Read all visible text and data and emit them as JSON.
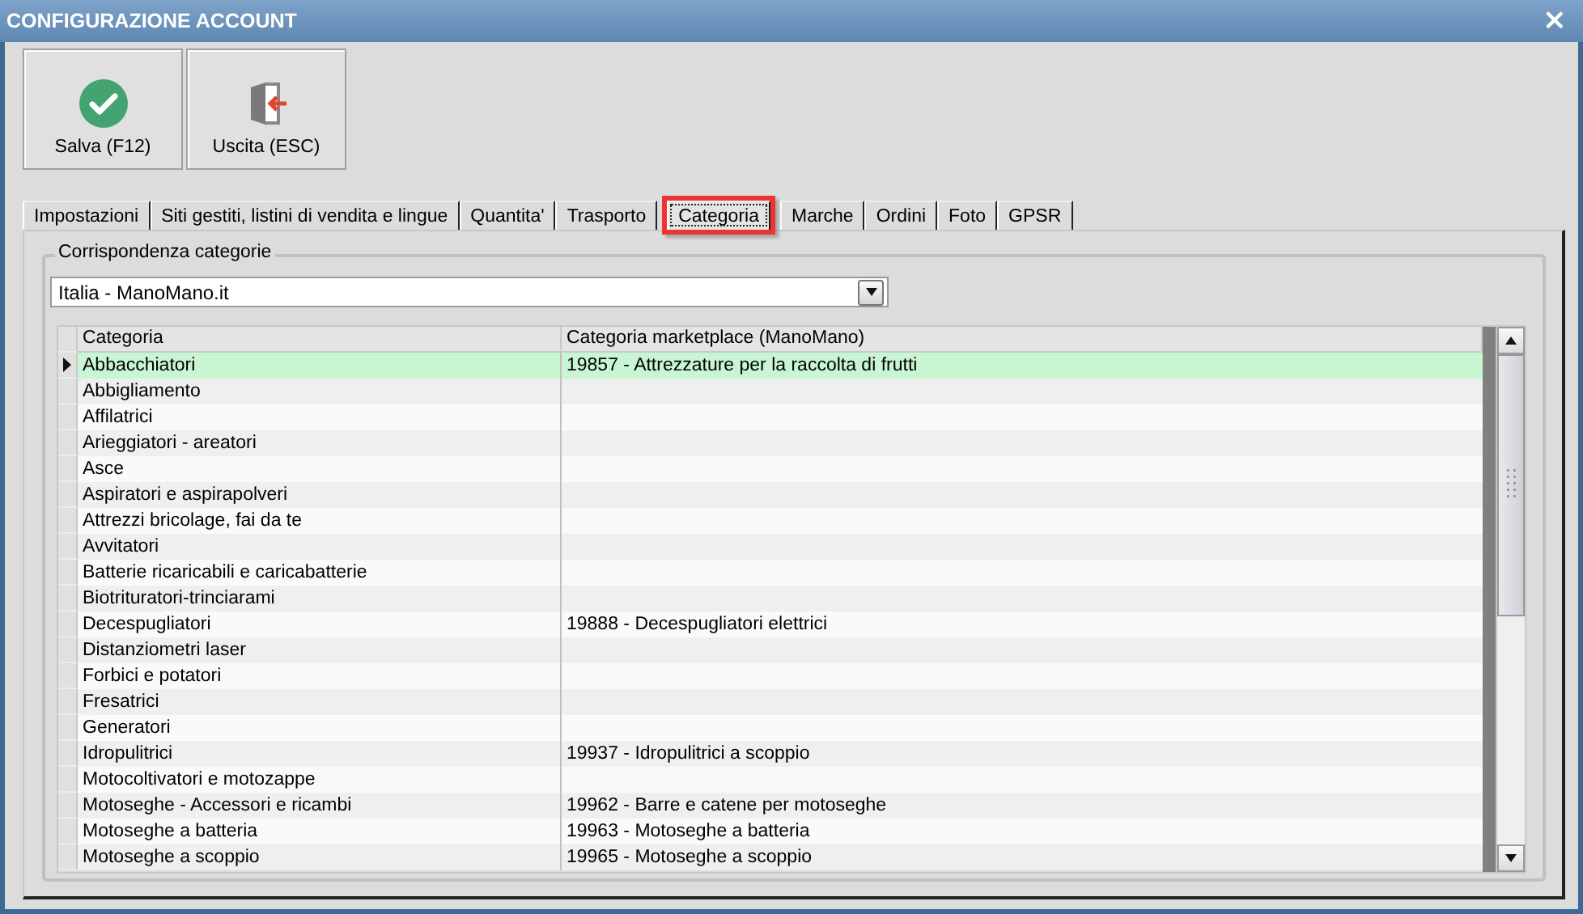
{
  "window": {
    "title": "CONFIGURAZIONE ACCOUNT",
    "close": "×"
  },
  "toolbar": [
    {
      "kind": "save",
      "label": "Salva (F12)"
    },
    {
      "kind": "exit",
      "label": "Uscita (ESC)"
    }
  ],
  "tabs": [
    {
      "label": "Impostazioni",
      "selected": false,
      "highlighted": false
    },
    {
      "label": "Siti gestiti, listini di vendita e lingue",
      "selected": false,
      "highlighted": false
    },
    {
      "label": "Quantita'",
      "selected": false,
      "highlighted": false
    },
    {
      "label": "Trasporto",
      "selected": false,
      "highlighted": false
    },
    {
      "label": "Categoria",
      "selected": true,
      "highlighted": true
    },
    {
      "label": "Marche",
      "selected": false,
      "highlighted": false
    },
    {
      "label": "Ordini",
      "selected": false,
      "highlighted": false
    },
    {
      "label": "Foto",
      "selected": false,
      "highlighted": false
    },
    {
      "label": "GPSR",
      "selected": false,
      "highlighted": false
    }
  ],
  "group": {
    "title": "Corrispondenza categorie",
    "dropdown": {
      "value": "Italia - ManoMano.it"
    }
  },
  "table": {
    "columns": [
      "Categoria",
      "Categoria marketplace (ManoMano)"
    ],
    "rows": [
      {
        "cells": [
          "Abbacchiatori",
          "19857 - Attrezzature per la raccolta di frutti"
        ],
        "selected": true
      },
      {
        "cells": [
          "Abbigliamento",
          ""
        ],
        "selected": false
      },
      {
        "cells": [
          "Affilatrici",
          ""
        ],
        "selected": false
      },
      {
        "cells": [
          "Arieggiatori - areatori",
          ""
        ],
        "selected": false
      },
      {
        "cells": [
          "Asce",
          ""
        ],
        "selected": false
      },
      {
        "cells": [
          "Aspiratori e aspirapolveri",
          ""
        ],
        "selected": false
      },
      {
        "cells": [
          "Attrezzi bricolage, fai da te",
          ""
        ],
        "selected": false
      },
      {
        "cells": [
          "Avvitatori",
          ""
        ],
        "selected": false
      },
      {
        "cells": [
          "Batterie ricaricabili e caricabatterie",
          ""
        ],
        "selected": false
      },
      {
        "cells": [
          "Biotrituratori-trinciarami",
          ""
        ],
        "selected": false
      },
      {
        "cells": [
          "Decespugliatori",
          "19888 - Decespugliatori elettrici"
        ],
        "selected": false
      },
      {
        "cells": [
          "Distanziometri laser",
          ""
        ],
        "selected": false
      },
      {
        "cells": [
          "Forbici e potatori",
          ""
        ],
        "selected": false
      },
      {
        "cells": [
          "Fresatrici",
          ""
        ],
        "selected": false
      },
      {
        "cells": [
          "Generatori",
          ""
        ],
        "selected": false
      },
      {
        "cells": [
          "Idropulitrici",
          "19937 - Idropulitrici a scoppio"
        ],
        "selected": false
      },
      {
        "cells": [
          "Motocoltivatori e motozappe",
          ""
        ],
        "selected": false
      },
      {
        "cells": [
          "Motoseghe - Accessori e ricambi",
          "19962 - Barre e catene per motoseghe"
        ],
        "selected": false
      },
      {
        "cells": [
          "Motoseghe a batteria",
          "19963 - Motoseghe a batteria"
        ],
        "selected": false
      },
      {
        "cells": [
          "Motoseghe a scoppio",
          "19965 - Motoseghe a scoppio"
        ],
        "selected": false
      }
    ]
  }
}
